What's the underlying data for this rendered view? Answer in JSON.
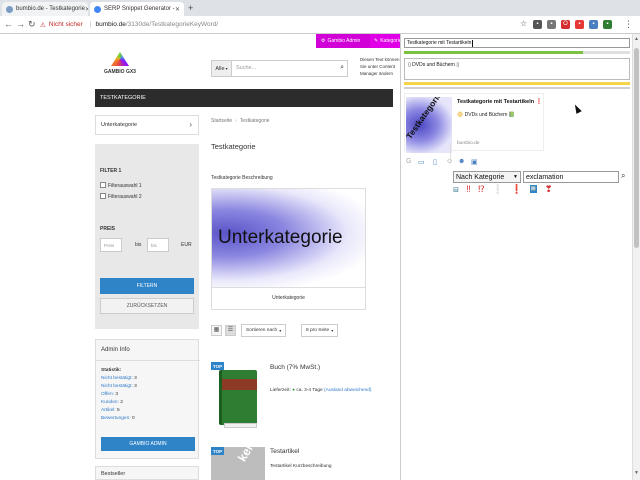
{
  "browser": {
    "tabs": [
      {
        "label": "bumbio.de - Testkategorie"
      },
      {
        "label": "SERP Snippet Generator -"
      }
    ],
    "address": {
      "security": "Nicht sicher",
      "host": "bumbio.de",
      "path": "/3130de/TestkategorieKeyWord/"
    }
  },
  "admin_bar": {
    "gambio_admin": "Gambio Admin",
    "kategorie": "Kategorie"
  },
  "shop": {
    "logo_text": "GAMBIO GX3",
    "search": {
      "select_value": "Alle",
      "placeholder": "Suche..."
    },
    "cms_note": "Diesen Text können Sie unter Content Manager ändern",
    "category_nav": "TESTKATEGORIE",
    "sidebar_subcategory": "Unterkategorie",
    "filter": {
      "title": "FILTER 1",
      "option1": "Filterauswahl 1",
      "option2": "Filterauswahl 2",
      "price_label": "PREIS",
      "from_placeholder": "Preis",
      "to_label": "bis",
      "to_placeholder": "bis",
      "currency": "EUR",
      "filter_button": "FILTERN",
      "reset_button": "ZURÜCKSETZEN"
    },
    "admin_info": {
      "title": "Admin Info",
      "stats_label": "Statistik:",
      "stats": [
        {
          "label": "Nicht bestätigt:",
          "value": "3"
        },
        {
          "label": "Nicht bestätigt:",
          "value": "3"
        },
        {
          "label": "Offen:",
          "value": "3"
        },
        {
          "label": "Kunden:",
          "value": "2"
        },
        {
          "label": "Artikel:",
          "value": "5"
        },
        {
          "label": "Bewertungen:",
          "value": "0"
        }
      ],
      "button": "GAMBIO ADMIN"
    },
    "bestseller": "Bestseller",
    "breadcrumb": [
      "Startseite",
      "Testkategorie"
    ],
    "page_title": "Testkategorie",
    "category_description": "Testkategorie Beschreibung",
    "subcategory_card": {
      "image_text": "Unterkategorie",
      "caption": "Unterkategorie"
    },
    "listing": {
      "sort_label": "Sortieren nach",
      "per_page": "8 pro Seite"
    },
    "products": [
      {
        "badge": "TOP",
        "name": "Buch (7% MwSt.)",
        "delivery_label": "Lieferzeit:",
        "delivery_value": "ca. 3-4 Tage",
        "delivery_note": "(Ausland abweichend)"
      },
      {
        "badge": "TOP",
        "name": "Testartikel",
        "short_desc": "Testartikel Kurzbeschreibung",
        "image_text": "kein Bild"
      }
    ]
  },
  "serp": {
    "title_input": "Testkategorie mit Testartikeln",
    "title_progress": 0.79,
    "description_input": "DVDs und Büchern",
    "description_progress": 1.0,
    "preview": {
      "thumb_text": "Testkategorie",
      "title": "Testkategorie mit Testartikeln",
      "title_emoji": "❗",
      "desc_prefix_emoji": "📀",
      "desc": "DVDs und Büchern",
      "desc_suffix_emoji": "📗",
      "url": "bumbio.de"
    },
    "emoji_category": "Nach Kategorie",
    "emoji_search_value": "exclamation",
    "emojis": [
      "🔛",
      "‼",
      "⁉",
      "❕",
      "❗",
      "🆙",
      "❣"
    ]
  },
  "colors": {
    "accent_blue": "#2f84c8",
    "admin_magenta": "#d100d6",
    "progress_green": "#7cc242",
    "progress_yellow": "#f5d547"
  },
  "icons": {
    "reload": "reload-icon",
    "star": "star-icon",
    "search": "search-icon"
  }
}
